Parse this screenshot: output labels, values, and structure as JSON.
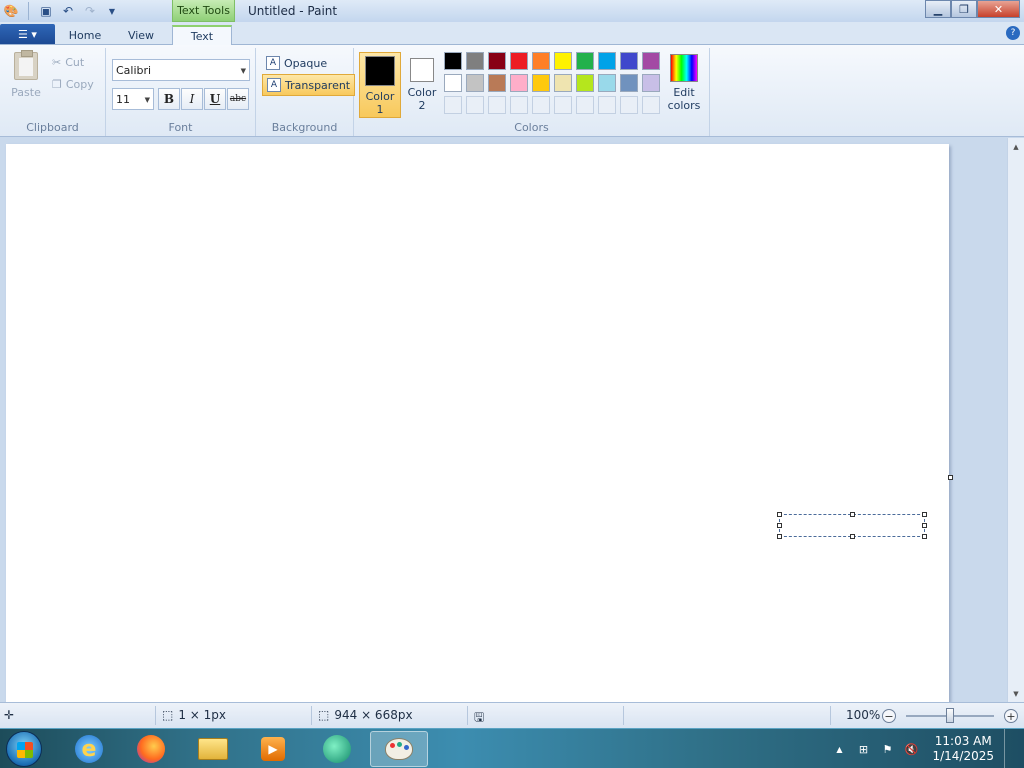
{
  "window": {
    "title": "Untitled - Paint",
    "context_tab": "Text Tools",
    "qat": {
      "save_icon": "save-icon",
      "undo_icon": "undo-icon",
      "redo_icon": "redo-icon",
      "customize_icon": "chevron-down-icon"
    }
  },
  "tabs": [
    {
      "label": "Home",
      "active": false
    },
    {
      "label": "View",
      "active": false
    },
    {
      "label": "Text",
      "active": true
    }
  ],
  "ribbon": {
    "clipboard": {
      "label": "Clipboard",
      "paste": "Paste",
      "cut": "Cut",
      "copy": "Copy"
    },
    "font": {
      "label": "Font",
      "family": "Calibri",
      "size": "11",
      "bold": "B",
      "italic": "I",
      "underline": "U",
      "strikethrough": "abc"
    },
    "background": {
      "label": "Background",
      "opaque": "Opaque",
      "transparent": "Transparent",
      "selected": "transparent"
    },
    "colors": {
      "label": "Colors",
      "color1_label": "Color",
      "color1_num": "1",
      "color2_label": "Color",
      "color2_num": "2",
      "color1": "#000000",
      "color2": "#ffffff",
      "edit_label": "Edit",
      "edit_label2": "colors",
      "palette_row1": [
        "#000000",
        "#7f7f7f",
        "#880015",
        "#ed1c24",
        "#ff7f27",
        "#fff200",
        "#22b14c",
        "#00a2e8",
        "#3f48cc",
        "#a349a4"
      ],
      "palette_row2": [
        "#ffffff",
        "#c3c3c3",
        "#b97a57",
        "#ffaec9",
        "#ffc90e",
        "#efe4b0",
        "#b5e61d",
        "#99d9ea",
        "#7092be",
        "#c8bfe7"
      ]
    }
  },
  "status": {
    "selection_size": "1 × 1px",
    "canvas_size": "944 × 668px",
    "zoom": "100%"
  },
  "taskbar": {
    "time": "11:03 AM",
    "date": "1/14/2025"
  }
}
